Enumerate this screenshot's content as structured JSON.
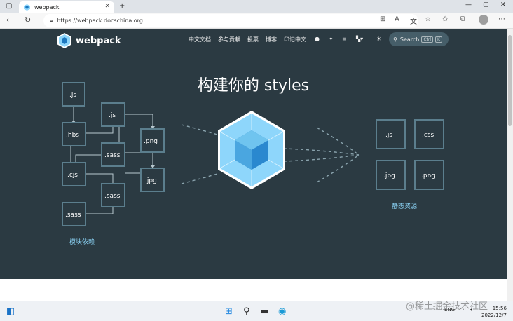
{
  "browser": {
    "tab": {
      "title": "webpack"
    },
    "address": {
      "url": "https://webpack.docschina.org"
    }
  },
  "site": {
    "logo_text": "webpack",
    "nav": [
      "中文文档",
      "参与贡献",
      "投票",
      "博客",
      "印记中文"
    ],
    "search": {
      "label": "Search",
      "kbd1": "Ctrl",
      "kbd2": "K"
    },
    "hero_title": "构建你的 styles",
    "modules_caption": "模块依赖",
    "assets_caption": "静态资源",
    "modules": [
      ".js",
      ".js",
      ".hbs",
      ".png",
      ".sass",
      ".cjs",
      ".jpg",
      ".sass",
      ".sass"
    ],
    "assets": [
      ".js",
      ".css",
      ".jpg",
      ".png"
    ]
  },
  "taskbar": {
    "lang": "ENG",
    "time": "15:56",
    "date": "2022/12/7"
  },
  "watermark": "@稀土掘金技术社区",
  "colors": {
    "page_bg": "#2b3a42",
    "accent": "#8dd6f9",
    "cube_light": "#8ed6fb",
    "cube_dark": "#1c78c0",
    "box_border": "#5b7e8d"
  }
}
